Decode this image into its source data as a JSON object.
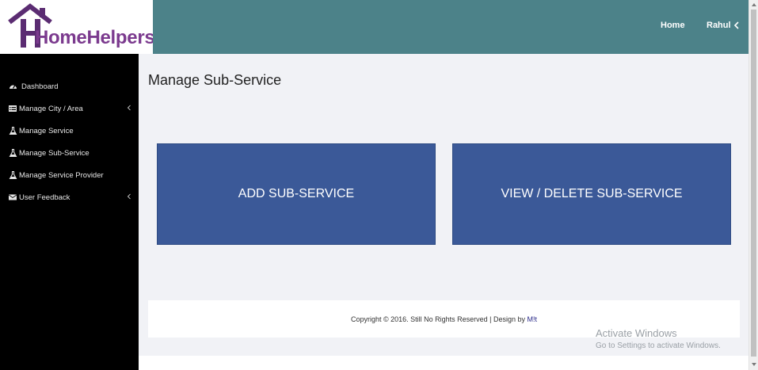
{
  "brand": {
    "logo_text": "HomeHelpers",
    "logo_color": "#7b3a8e",
    "house_color": "#5b2c72"
  },
  "topbar": {
    "home_label": "Home",
    "user_label": "Rahul",
    "color": "#4c8289"
  },
  "sidebar": {
    "items": [
      {
        "label": "Dashboard",
        "icon": "dashboard-gauge-icon",
        "has_submenu": false
      },
      {
        "label": "Manage City / Area",
        "icon": "list-icon",
        "has_submenu": true
      },
      {
        "label": "Manage Service",
        "icon": "flask-icon",
        "has_submenu": false
      },
      {
        "label": "Manage Sub-Service",
        "icon": "flask-icon",
        "has_submenu": false
      },
      {
        "label": "Manage Service Provider",
        "icon": "flask-icon",
        "has_submenu": false
      },
      {
        "label": "User Feedback",
        "icon": "envelope-icon",
        "has_submenu": true
      }
    ]
  },
  "main": {
    "title": "Manage Sub-Service",
    "add_button": "ADD SUB-SERVICE",
    "view_button": "VIEW / DELETE SUB-SERVICE",
    "card_color": "#3b5998"
  },
  "footer": {
    "text": "Copyright © 2016. Still No Rights Reserved | Design by ",
    "link": "M!t"
  },
  "watermark": {
    "title": "Activate Windows",
    "subtitle": "Go to Settings to activate Windows."
  }
}
